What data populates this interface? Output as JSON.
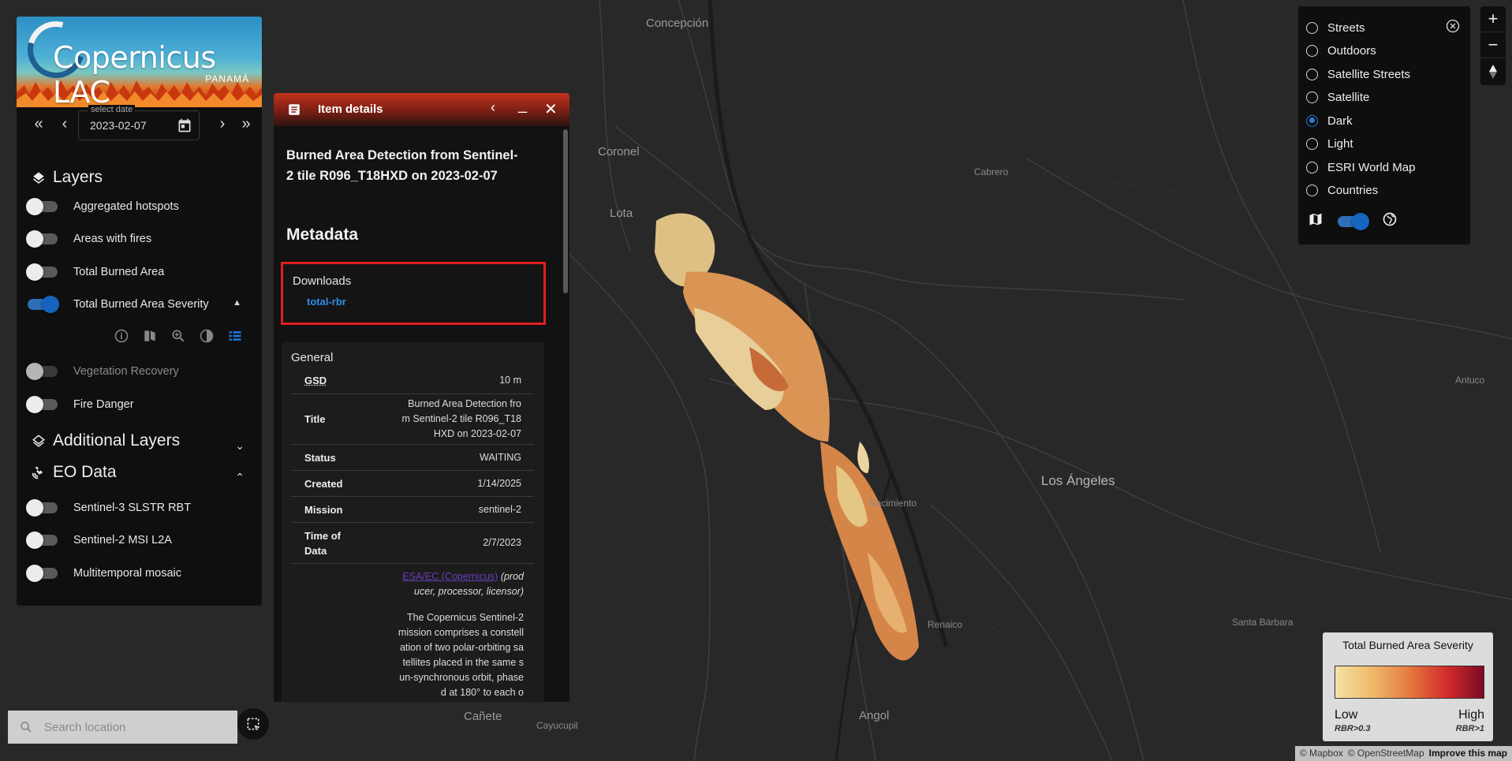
{
  "map": {
    "places": [
      "Concepción",
      "Coronel",
      "Lota",
      "Cabrero",
      "Antuco",
      "Los Ángeles",
      "Nacimiento",
      "Renaico",
      "Santa Bárbara",
      "Angol",
      "Cañete",
      "Cayucupil"
    ]
  },
  "left_panel": {
    "logo": {
      "brand": "Copernicus LAC",
      "sub": "PANAMÁ"
    },
    "date": {
      "label": "select date",
      "value": "2023-02-07"
    },
    "nav": {
      "first": "«",
      "prev": "‹",
      "next": "›",
      "last": "»"
    },
    "layers_title": "Layers",
    "layers": [
      {
        "label": "Aggregated hotspots",
        "on": false
      },
      {
        "label": "Areas with fires",
        "on": false
      },
      {
        "label": "Total Burned Area",
        "on": false
      },
      {
        "label": "Total Burned Area Severity",
        "on": true
      },
      {
        "label": "Vegetation Recovery",
        "on": false
      },
      {
        "label": "Fire Danger",
        "on": false
      }
    ],
    "additional_title": "Additional Layers",
    "eo_title": "EO Data",
    "eo_layers": [
      {
        "label": "Sentinel-3 SLSTR RBT",
        "on": false
      },
      {
        "label": "Sentinel-2 MSI L2A",
        "on": false
      },
      {
        "label": "Multitemporal mosaic",
        "on": false
      }
    ]
  },
  "details": {
    "header": "Item details",
    "title": "Burned Area Detection from Sentinel-2 tile R096_T18HXD on 2023-02-07",
    "metadata_heading": "Metadata",
    "downloads_label": "Downloads",
    "download_link": "total-rbr",
    "general_label": "General",
    "rows": [
      {
        "k": "GSD",
        "v": "10 m"
      },
      {
        "k": "Title",
        "v": "Burned Area Detection from Sentinel-2 tile R096_T18HXD on 2023-02-07"
      },
      {
        "k": "Status",
        "v": "WAITING"
      },
      {
        "k": "Created",
        "v": "1/14/2025"
      },
      {
        "k": "Mission",
        "v": "sentinel-2"
      },
      {
        "k": "Time of Data",
        "v": "2/7/2023"
      }
    ],
    "provider_link": "ESA/EC (Copernicus)",
    "provider_roles": "(producer, processor, licensor)",
    "description": "The Copernicus Sentinel-2 mission comprises a constellation of two polar-orbiting satellites placed in the same sun-synchronous orbit, phased at 180° to each o"
  },
  "basemaps": {
    "options": [
      "Streets",
      "Outdoors",
      "Satellite Streets",
      "Satellite",
      "Dark",
      "Light",
      "ESRI World Map",
      "Countries"
    ],
    "selected": "Dark"
  },
  "zoom": {
    "in": "+",
    "out": "−"
  },
  "legend": {
    "title": "Total Burned Area Severity",
    "low": "Low",
    "low_sub": "RBR>0.3",
    "high": "High",
    "high_sub": "RBR>1"
  },
  "search": {
    "placeholder": "Search location"
  },
  "attribution": {
    "mapbox": "© Mapbox",
    "osm": "© OpenStreetMap",
    "improve": "Improve this map"
  },
  "colors": {
    "accent": "#1565c0",
    "highlight": "#e01e1e",
    "link": "#2f8fe8"
  }
}
